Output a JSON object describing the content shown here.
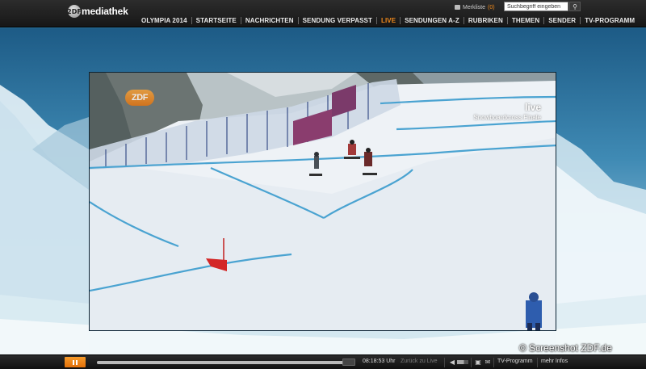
{
  "header": {
    "logo_badge": "2DF",
    "logo_text": "mediathek",
    "merkliste_label": "Merkliste",
    "merkliste_count": "(0)",
    "search_placeholder": "Suchbegriff eingeben",
    "nav": [
      {
        "label": "OLYMPIA 2014"
      },
      {
        "label": "STARTSEITE"
      },
      {
        "label": "NACHRICHTEN"
      },
      {
        "label": "SENDUNG VERPASST"
      },
      {
        "label": "LIVE"
      },
      {
        "label": "SENDUNGEN A-Z"
      },
      {
        "label": "RUBRIKEN"
      },
      {
        "label": "THEMEN"
      },
      {
        "label": "SENDER"
      },
      {
        "label": "TV-PROGRAMM"
      }
    ]
  },
  "video": {
    "channel_bug": "ZDF",
    "live_label": "live",
    "event_label": "Snowboardcross Finale"
  },
  "player": {
    "time": "08:18:53 Uhr",
    "back_to_live": "Zurück zu Live",
    "tv_programm": "TV-Programm",
    "mehr_infos": "mehr Infos",
    "progress": 0.95
  },
  "watermark": "© Screenshot ZDF.de",
  "colors": {
    "accent": "#f08a1c",
    "header_bg": "#1f1f1f"
  }
}
